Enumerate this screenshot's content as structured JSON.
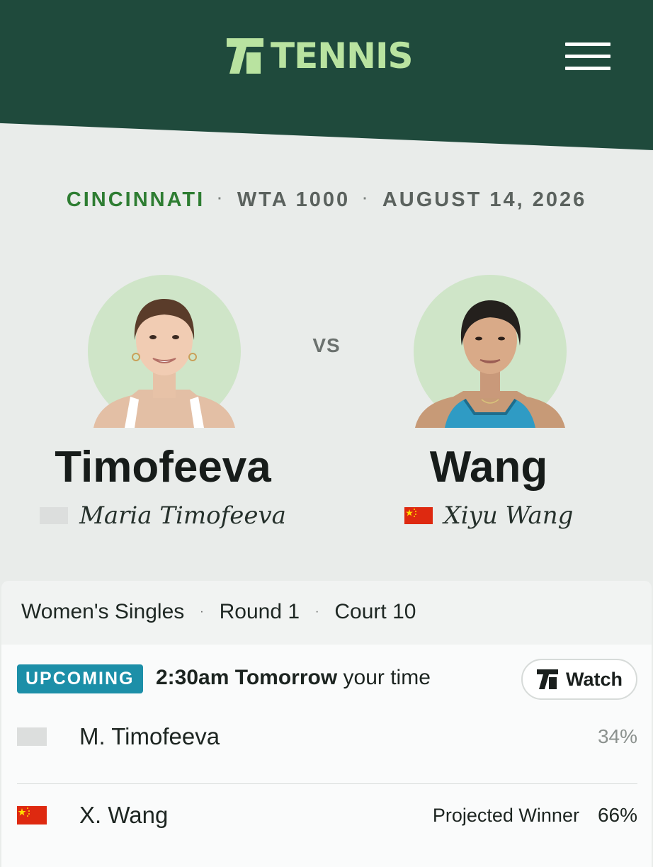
{
  "header": {
    "logo_text": "TENNIS",
    "logo_color": "#b9e3a0",
    "bg_color": "#1f4a3c"
  },
  "meta": {
    "city": "CINCINNATI",
    "tournament": "WTA 1000",
    "date": "AUGUST 14, 2026",
    "separator": "·"
  },
  "players": [
    {
      "surname": "Timofeeva",
      "full_name": "Maria Timofeeva",
      "flag": "blank",
      "short_name": "M. Timofeeva",
      "win_pct": "34%"
    },
    {
      "surname": "Wang",
      "full_name": "Xiyu Wang",
      "flag": "china",
      "short_name": "X. Wang",
      "win_pct": "66%",
      "projected_label": "Projected Winner"
    }
  ],
  "vs_label": "VS",
  "match": {
    "event": "Women's Singles",
    "round": "Round 1",
    "court": "Court 10",
    "separator": "·",
    "status": "UPCOMING",
    "status_color": "#1c8fa8",
    "time_bold": "2:30am Tomorrow",
    "time_suffix": " your time",
    "watch_label": "Watch"
  }
}
